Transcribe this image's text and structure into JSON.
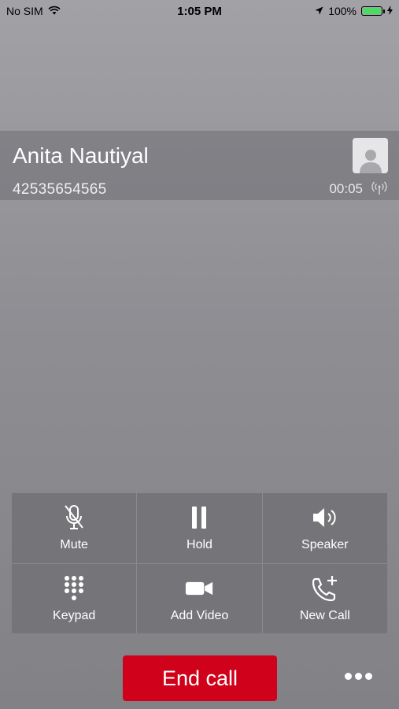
{
  "status_bar": {
    "carrier": "No SIM",
    "time": "1:05 PM",
    "battery_percent": "100%",
    "battery_level": 1.0,
    "icons": [
      "wifi-icon",
      "location-arrow-icon",
      "battery-icon",
      "charging-bolt-icon"
    ]
  },
  "caller": {
    "name": "Anita Nautiyal",
    "number": "42535654565",
    "duration": "00:05",
    "avatar_icon": "person-silhouette-icon",
    "signal_icon": "signal-waves-icon"
  },
  "controls": [
    {
      "label": "Mute",
      "icon": "mic-off-icon"
    },
    {
      "label": "Hold",
      "icon": "pause-icon"
    },
    {
      "label": "Speaker",
      "icon": "speaker-icon"
    },
    {
      "label": "Keypad",
      "icon": "keypad-icon"
    },
    {
      "label": "Add Video",
      "icon": "video-camera-icon"
    },
    {
      "label": "New Call",
      "icon": "phone-plus-icon"
    }
  ],
  "end_call": {
    "label": "End call",
    "color": "#d0021b"
  },
  "more_icon": "more-dots-icon",
  "colors": {
    "battery_fill": "#4cd964",
    "end_call": "#d0021b"
  }
}
